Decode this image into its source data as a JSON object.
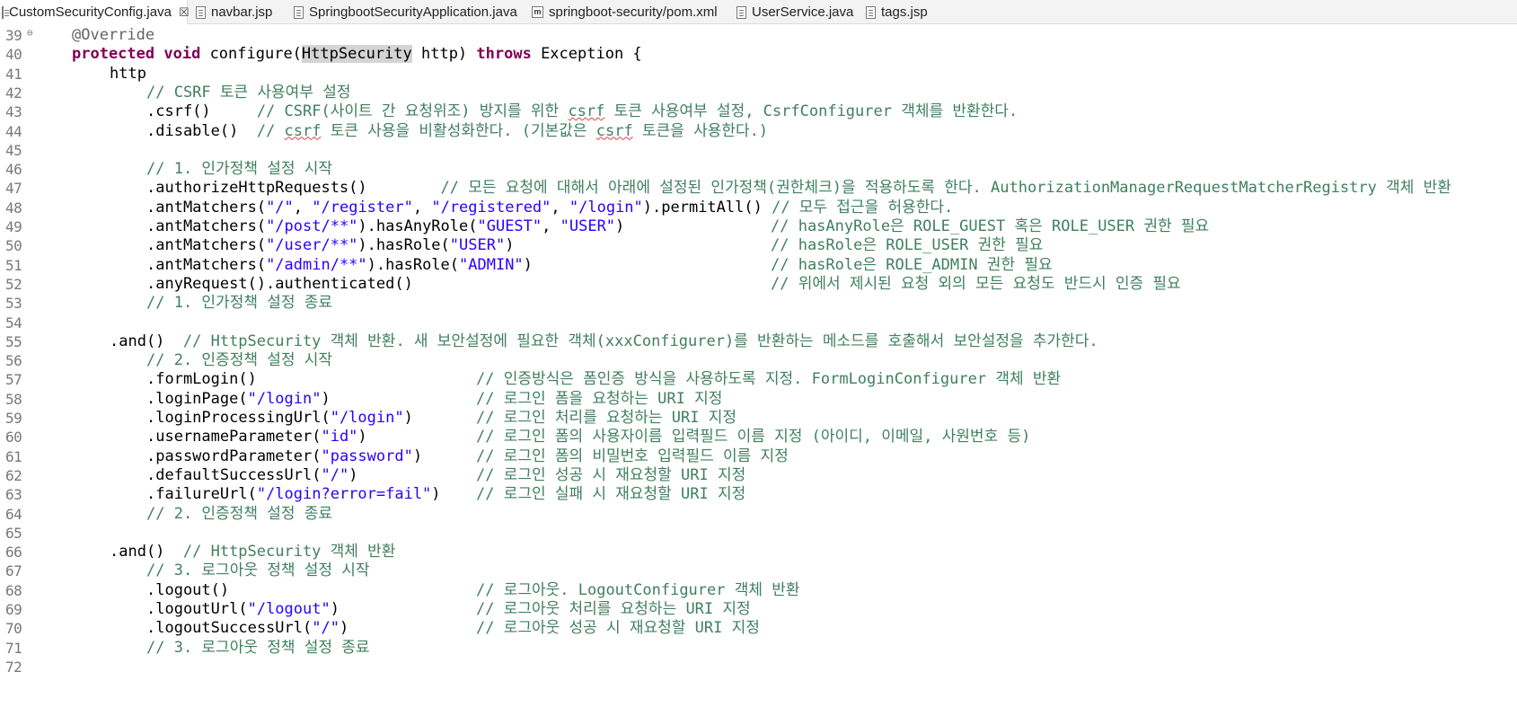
{
  "tabs": [
    {
      "label": "CustomSecurityConfig.java",
      "icon": "java-file-icon",
      "active": true,
      "closable": true
    },
    {
      "label": "navbar.jsp",
      "icon": "jsp-file-icon"
    },
    {
      "label": "SpringbootSecurityApplication.java",
      "icon": "java-file-icon"
    },
    {
      "label": "springboot-security/pom.xml",
      "icon": "xml-file-icon"
    },
    {
      "label": "UserService.java",
      "icon": "java-file-icon"
    },
    {
      "label": "tags.jsp",
      "icon": "jsp-file-icon"
    }
  ],
  "editor": {
    "lines": [
      {
        "n": "39",
        "t": "@Override"
      },
      {
        "n": "40",
        "t": "protected void configure(HttpSecurity http) throws Exception {"
      },
      {
        "n": "41",
        "t": "http"
      },
      {
        "n": "42",
        "t": "// CSRF 토큰 사용여부 설정"
      },
      {
        "n": "43",
        "t": ".csrf()     // CSRF(사이트 간 요청위조) 방지를 위한 csrf 토큰 사용여부 설정, CsrfConfigurer 객체를 반환한다."
      },
      {
        "n": "44",
        "t": ".disable()  // csrf 토큰 사용을 비활성화한다. (기본값은 csrf 토큰을 사용한다.)"
      },
      {
        "n": "45",
        "t": ""
      },
      {
        "n": "46",
        "t": "// 1. 인가정책 설정 시작"
      },
      {
        "n": "47",
        "t": ".authorizeHttpRequests()        // 모든 요청에 대해서 아래에 설정된 인가정책(권한체크)을 적용하도록 한다. AuthorizationManagerRequestMatcherRegistry 객체 반환"
      },
      {
        "n": "48",
        "t": ".antMatchers(\"/\", \"/register\", \"/registered\", \"/login\").permitAll() // 모두 접근을 허용한다."
      },
      {
        "n": "49",
        "t": ".antMatchers(\"/post/**\").hasAnyRole(\"GUEST\", \"USER\")"
      },
      {
        "n": "50",
        "t": ".antMatchers(\"/user/**\").hasRole(\"USER\")"
      },
      {
        "n": "51",
        "t": ".antMatchers(\"/admin/**\").hasRole(\"ADMIN\")"
      },
      {
        "n": "52",
        "t": ".anyRequest().authenticated()"
      },
      {
        "n": "53",
        "t": "// 1. 인가정책 설정 종료"
      },
      {
        "n": "54",
        "t": ""
      },
      {
        "n": "55",
        "t": ".and()  // HttpSecurity 객체 반환. 새 보안설정에 필요한 객체(xxxConfigurer)를 반환하는 메소드를 호출해서 보안설정을 추가한다."
      },
      {
        "n": "56",
        "t": "// 2. 인증정책 설정 시작"
      },
      {
        "n": "57",
        "t": ".formLogin()"
      },
      {
        "n": "58",
        "t": ".loginPage(\"/login\")"
      },
      {
        "n": "59",
        "t": ".loginProcessingUrl(\"/login\")"
      },
      {
        "n": "60",
        "t": ".usernameParameter(\"id\")"
      },
      {
        "n": "61",
        "t": ".passwordParameter(\"password\")"
      },
      {
        "n": "62",
        "t": ".defaultSuccessUrl(\"/\")"
      },
      {
        "n": "63",
        "t": ".failureUrl(\"/login?error=fail\")"
      },
      {
        "n": "64",
        "t": "// 2. 인증정책 설정 종료"
      },
      {
        "n": "65",
        "t": ""
      },
      {
        "n": "66",
        "t": ".and()  // HttpSecurity 객체 반환"
      },
      {
        "n": "67",
        "t": "// 3. 로그아웃 정책 설정 시작"
      },
      {
        "n": "68",
        "t": ".logout()"
      },
      {
        "n": "69",
        "t": ".logoutUrl(\"/logout\")"
      },
      {
        "n": "70",
        "t": ".logoutSuccessUrl(\"/\")"
      },
      {
        "n": "71",
        "t": "// 3. 로그아웃 정책 설정 종료"
      },
      {
        "n": "72",
        "t": ""
      }
    ],
    "comments": {
      "49": "// hasAnyRole은 ROLE_GUEST 혹은 ROLE_USER 권한 필요",
      "50": "// hasRole은 ROLE_USER 권한 필요",
      "51": "// hasRole은 ROLE_ADMIN 권한 필요",
      "52": "// 위에서 제시된 요청 외의 모든 요청도 반드시 인증 필요",
      "57": "// 인증방식은 폼인증 방식을 사용하도록 지정. FormLoginConfigurer 객체 반환",
      "58": "// 로그인 폼을 요청하는 URI 지정",
      "59": "// 로그인 처리를 요청하는 URI 지정",
      "60": "// 로그인 폼의 사용자이름 입력필드 이름 지정 (아이디, 이메일, 사원번호 등)",
      "61": "// 로그인 폼의 비밀번호 입력필드 이름 지정",
      "62": "// 로그인 성공 시 재요청할 URI 지정",
      "63": "// 로그인 실패 시 재요청할 URI 지정",
      "68": "// 로그아웃. LogoutConfigurer 객체 반환",
      "69": "// 로그아웃 처리를 요청하는 URI 지정",
      "70": "// 로그아웃 성공 시 재요청할 URI 지정"
    }
  }
}
